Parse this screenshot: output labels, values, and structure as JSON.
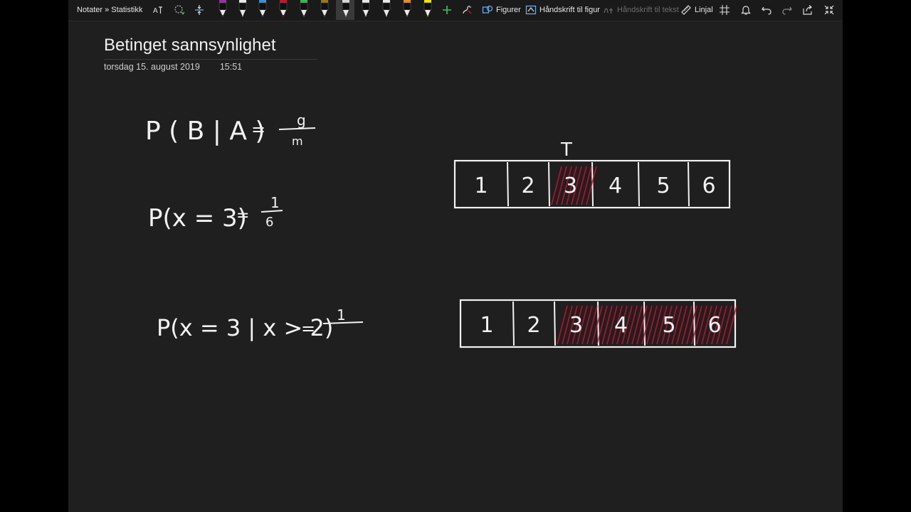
{
  "breadcrumb": "Notater » Statistikk",
  "toolbar": {
    "figurer": "Figurer",
    "handskrift_til_figur": "Håndskrift til figur",
    "handskrift_til_tekst": "Håndskrift til tekst",
    "linjal": "Linjal"
  },
  "pens": [
    {
      "color": "#9b2fa8"
    },
    {
      "color": "#e8e8e8"
    },
    {
      "color": "#3b8fe0"
    },
    {
      "color": "#d0102a"
    },
    {
      "color": "#2fbf4a"
    },
    {
      "color": "#9a7a10"
    },
    {
      "color": "#d8d8d8"
    },
    {
      "color": "#e8e8e8"
    },
    {
      "color": "#e8e8e8"
    },
    {
      "color": "#f08a1c"
    },
    {
      "color": "#f5e400"
    }
  ],
  "page": {
    "title": "Betinget sannsynlighet",
    "date": "torsdag 15. august 2019",
    "time": "15:51"
  },
  "ink": {
    "eq1_left": "P ( B | A )",
    "eq1_equals": "=",
    "eq1_num": "g",
    "eq1_den": "m",
    "eq2_left": "P(x = 3)",
    "eq2_equals": "=",
    "eq2_num": "1",
    "eq2_den": "6",
    "eq3_left": "P(x = 3 | x > 2)",
    "eq3_equals": "=",
    "eq3_num": "1",
    "top_label": "T",
    "die_faces": [
      "1",
      "2",
      "3",
      "4",
      "5",
      "6"
    ],
    "hatch_color": "#c8102e"
  }
}
